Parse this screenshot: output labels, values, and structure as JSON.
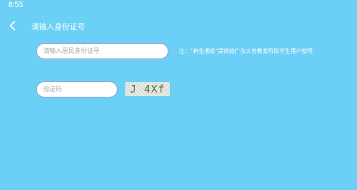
{
  "status_bar": {
    "time": "8:55"
  },
  "header": {
    "title": "请输入身份证号"
  },
  "form": {
    "id_placeholder": "请输入居民身份证号",
    "note": "注：“新生通道”提供给广东义务教育阶段学生用户使用",
    "captcha_placeholder": "验证码",
    "captcha_code": "J 4Xf"
  },
  "colors": {
    "background": "#6ccff6",
    "input_border": "#9aa4cf",
    "captcha_text": "#4f7440"
  },
  "icons": {
    "back": "chevron-left-icon"
  }
}
